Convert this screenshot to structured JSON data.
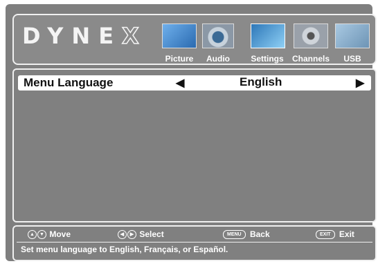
{
  "brand": {
    "logo_text": "DYNE",
    "logo_x": "X"
  },
  "tabs": [
    {
      "label": "Picture",
      "icon": "picture-icon",
      "color": "#3a7fc8",
      "active": false
    },
    {
      "label": "Audio",
      "icon": "audio-icon",
      "color": "#9fb0c0",
      "active": false
    },
    {
      "label": "Settings",
      "icon": "settings-icon",
      "color": "#4fa3e0",
      "active": true
    },
    {
      "label": "Channels",
      "icon": "channels-icon",
      "color": "#b8bec6",
      "active": false
    },
    {
      "label": "USB",
      "icon": "usb-icon",
      "color": "#8fb8d8",
      "active": false
    }
  ],
  "settings": {
    "option_name": "Menu Language",
    "left_arrow": "◀",
    "value": "English",
    "right_arrow": "▶"
  },
  "footer": {
    "move_label": "Move",
    "select_label": "Select",
    "menu_key": "MENU",
    "back_label": "Back",
    "exit_key": "EXIT",
    "exit_label": "Exit",
    "help_text": "Set menu language to English, Français, or Español."
  },
  "colors": {
    "accent": "#4fa3e0",
    "panel": "#808080",
    "border": "#f0f0f0"
  }
}
